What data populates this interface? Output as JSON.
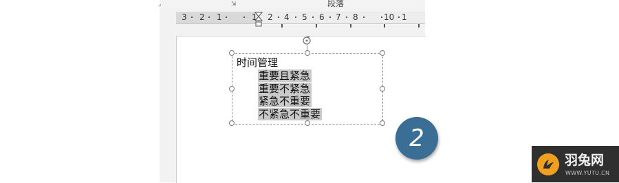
{
  "ribbon": {
    "group_label": "段落",
    "dialog_launcher_icon": "dialog-launcher-icon"
  },
  "ruler": {
    "labels_left": [
      "3",
      "2",
      "1"
    ],
    "labels_right": [
      "2",
      "4",
      "5",
      "6",
      "7",
      "8",
      "10",
      "1"
    ],
    "label_1_right": "1",
    "indent_marker_icon": "indent-marker-icon"
  },
  "textbox": {
    "title": "时间管理",
    "items": [
      "重要且紧急",
      "重要不紧急",
      "紧急不重要",
      "不紧急不重要"
    ],
    "rotate_icon": "rotate-icon"
  },
  "badge": {
    "number": "2",
    "color": "#3a6e95"
  },
  "watermark": {
    "title": "羽兔网",
    "url": "WWW.YUTU.CN",
    "logo_icon": "yutu-logo-icon",
    "accent": "#f0a020"
  }
}
